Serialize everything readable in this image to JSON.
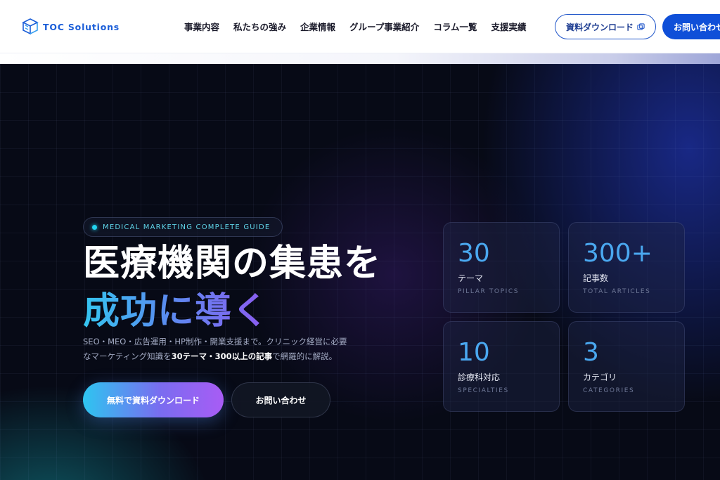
{
  "header": {
    "logo_text": "TOC Solutions",
    "nav": [
      "事業内容",
      "私たちの強み",
      "企業情報",
      "グループ事業紹介",
      "コラム一覧",
      "支援実績"
    ],
    "download_label": "資料ダウンロード",
    "contact_label": "お問い合わせ"
  },
  "hero": {
    "eyebrow": "MEDICAL MARKETING COMPLETE GUIDE",
    "title_line1": "医療機関の集患を",
    "title_line2": "成功に導く",
    "desc_line1": "SEO・MEO・広告運用・HP制作・開業支援まで。クリニック経営に必要",
    "desc_line2_pre": "なマーケティング知識を",
    "desc_line2_bold": "30テーマ・300以上の記事",
    "desc_line2_post": "で網羅的に解説。",
    "cta_primary": "無料で資料ダウンロード",
    "cta_secondary": "お問い合わせ"
  },
  "stats": [
    {
      "value": "30",
      "label": "テーマ",
      "sub": "PILLAR TOPICS"
    },
    {
      "value": "300+",
      "label": "記事数",
      "sub": "TOTAL ARTICLES"
    },
    {
      "value": "10",
      "label": "診療科対応",
      "sub": "SPECIALTIES"
    },
    {
      "value": "3",
      "label": "カテゴリ",
      "sub": "CATEGORIES"
    }
  ],
  "colors": {
    "brand": "#1b5ed8",
    "accent_cyan": "#22d3ee",
    "accent_purple": "#8d5af0",
    "hero_bg": "#070a16"
  },
  "icons": {
    "logo": "toc-cube-logo",
    "download": "copy-icon"
  }
}
